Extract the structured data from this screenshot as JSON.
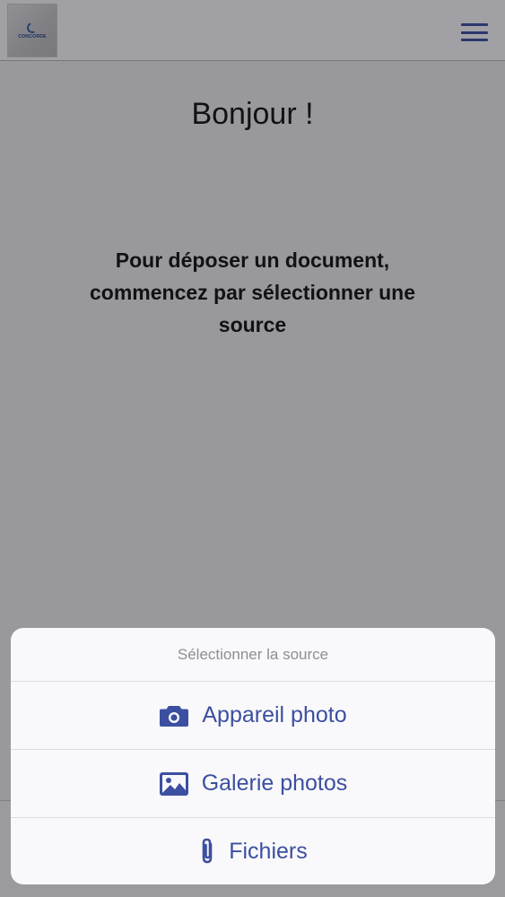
{
  "header": {
    "logo_text": "CONCORDE",
    "menu_icon": "hamburger-menu-icon"
  },
  "main": {
    "greeting": "Bonjour !",
    "instructions": "Pour déposer un document, commencez par sélectionner une source"
  },
  "action_sheet": {
    "title": "Sélectionner la source",
    "options": [
      {
        "label": "Appareil photo",
        "icon": "camera-icon"
      },
      {
        "label": "Galerie photos",
        "icon": "image-gallery-icon"
      },
      {
        "label": "Fichiers",
        "icon": "paperclip-icon"
      }
    ]
  },
  "colors": {
    "accent": "#3c4fa0",
    "sheet_title": "#8e8e93",
    "overlay": "rgba(20,20,30,0.40)"
  }
}
